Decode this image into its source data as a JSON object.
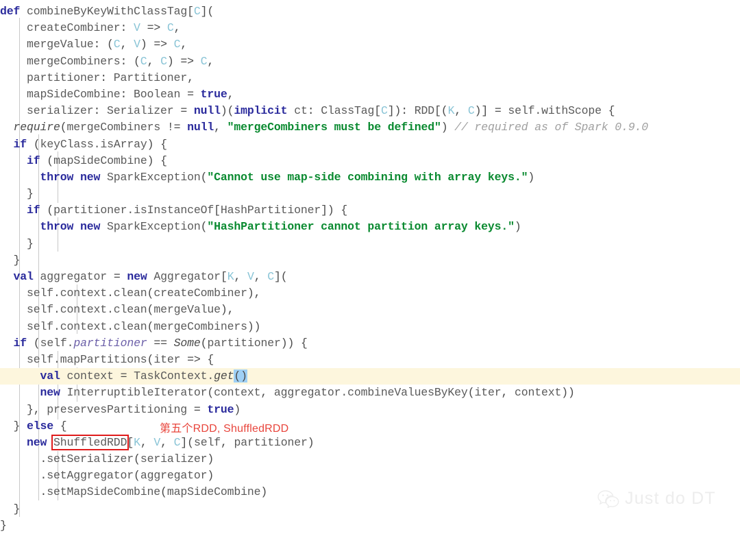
{
  "editor": {
    "language": "scala",
    "colors": {
      "background": "#ffffff",
      "keyword": "#2a2a9c",
      "string": "#0a8a30",
      "comment": "#a0a0a0",
      "type_param": "#89c4d6",
      "identifier": "#4a4a4a",
      "current_line_highlight": "#fdf6dd",
      "selection": "#9fd0f5",
      "annotation_red": "#e8453c",
      "indent_guide": "#c8c8c8"
    },
    "current_line_number": 23,
    "selected_text": "()"
  },
  "annotation": {
    "text": "第五个RDD, ShuffledRDD",
    "boxed_symbol": "ShuffledRDD"
  },
  "watermark": {
    "icon": "wechat-icon",
    "text": "Just do DT"
  },
  "code": {
    "lines": [
      "def combineByKeyWithClassTag[C](",
      "    createCombiner: V => C,",
      "    mergeValue: (C, V) => C,",
      "    mergeCombiners: (C, C) => C,",
      "    partitioner: Partitioner,",
      "    mapSideCombine: Boolean = true,",
      "    serializer: Serializer = null)(implicit ct: ClassTag[C]): RDD[(K, C)] = self.withScope {",
      "  require(mergeCombiners != null, \"mergeCombiners must be defined\") // required as of Spark 0.9.0",
      "  if (keyClass.isArray) {",
      "    if (mapSideCombine) {",
      "      throw new SparkException(\"Cannot use map-side combining with array keys.\")",
      "    }",
      "    if (partitioner.isInstanceOf[HashPartitioner]) {",
      "      throw new SparkException(\"HashPartitioner cannot partition array keys.\")",
      "    }",
      "  }",
      "  val aggregator = new Aggregator[K, V, C](",
      "    self.context.clean(createCombiner),",
      "    self.context.clean(mergeValue),",
      "    self.context.clean(mergeCombiners))",
      "  if (self.partitioner == Some(partitioner)) {",
      "    self.mapPartitions(iter => {",
      "      val context = TaskContext.get()",
      "      new InterruptibleIterator(context, aggregator.combineValuesByKey(iter, context))",
      "    }, preservesPartitioning = true)",
      "  } else {",
      "    new ShuffledRDD[K, V, C](self, partitioner)",
      "      .setSerializer(serializer)",
      "      .setAggregator(aggregator)",
      "      .setMapSideCombine(mapSideCombine)",
      "  }",
      "}"
    ]
  }
}
